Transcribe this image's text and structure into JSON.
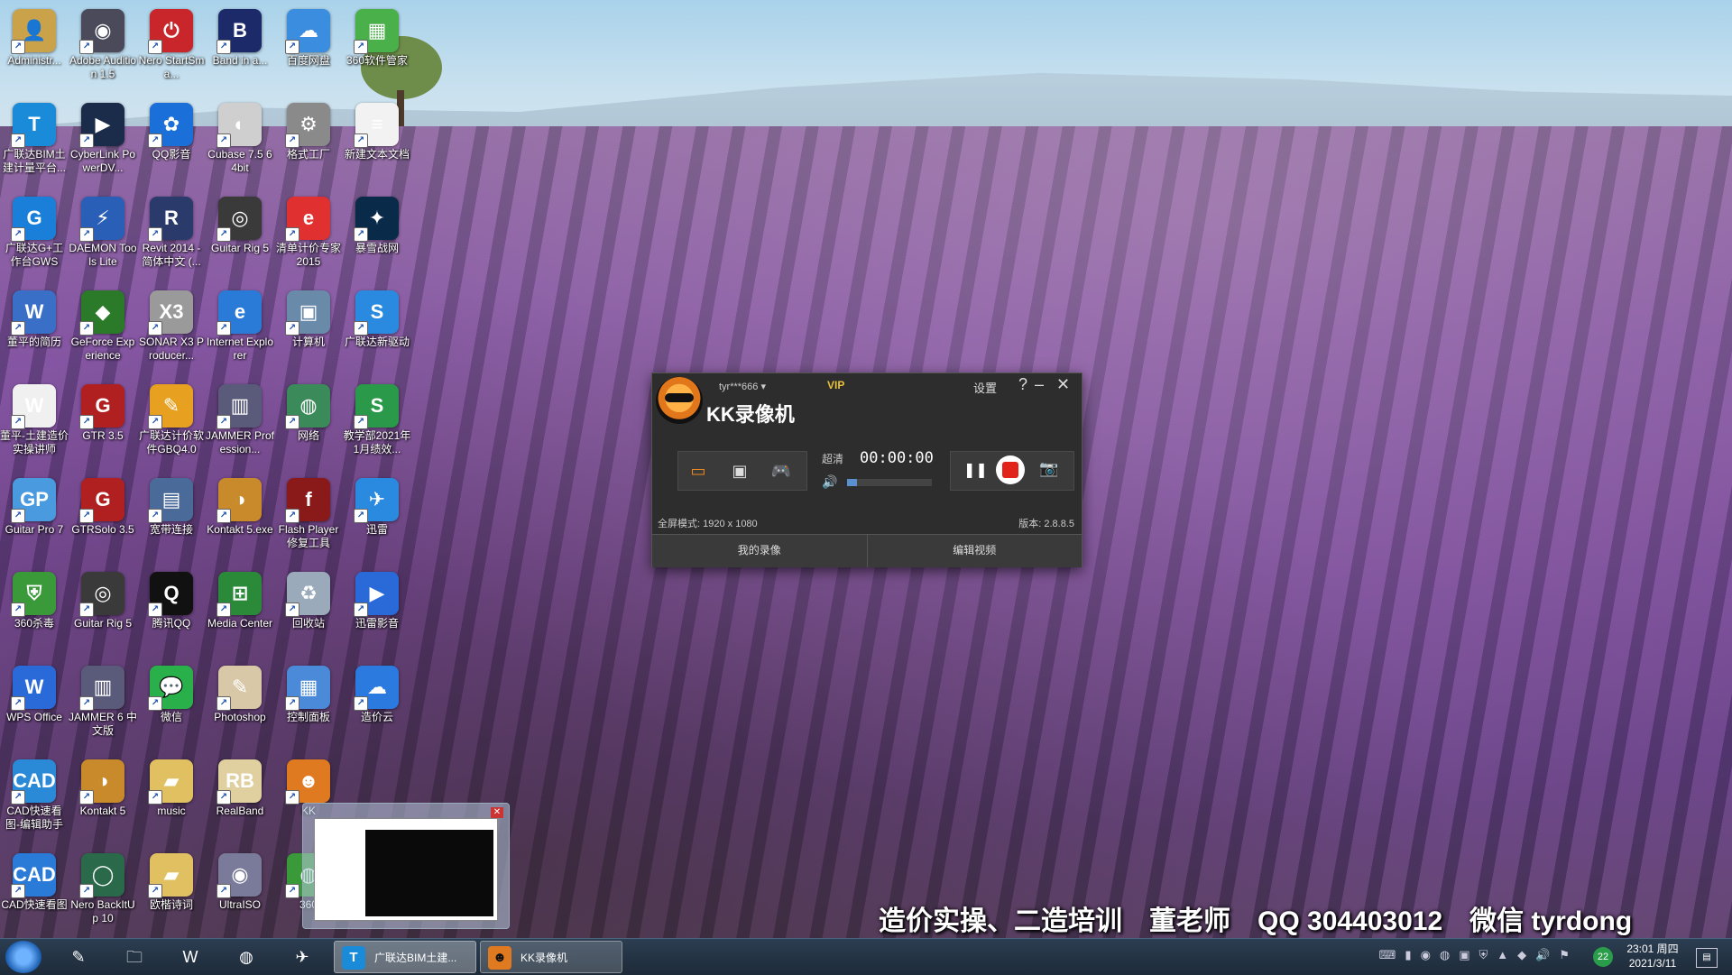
{
  "desktop_icons": [
    {
      "label": "Administr...",
      "color": "#c9a24a",
      "glyph": "👤"
    },
    {
      "label": "Adobe Audition 1.5",
      "color": "#4a4a5a",
      "glyph": "◉"
    },
    {
      "label": "Nero StartSma...",
      "color": "#c8262a",
      "glyph": "⏻"
    },
    {
      "label": "Band in a...",
      "color": "#1c2a6a",
      "glyph": "B"
    },
    {
      "label": "百度网盘",
      "color": "#3b8de0",
      "glyph": "☁"
    },
    {
      "label": "360软件管家",
      "color": "#49b04a",
      "glyph": "▦"
    },
    {
      "label": "广联达BIM土建计量平台...",
      "color": "#1a8bd8",
      "glyph": "T"
    },
    {
      "label": "CyberLink PowerDV...",
      "color": "#1b2b4a",
      "glyph": "▶"
    },
    {
      "label": "QQ影音",
      "color": "#1a6fd8",
      "glyph": "✿"
    },
    {
      "label": "Cubase 7.5 64bit",
      "color": "#cfcfcf",
      "glyph": "◐"
    },
    {
      "label": "格式工厂",
      "color": "#8a8a8a",
      "glyph": "⚙"
    },
    {
      "label": "新建文本文档",
      "color": "#f2f2f2",
      "glyph": "≡"
    },
    {
      "label": "广联达G+工作台GWS",
      "color": "#1a7fd8",
      "glyph": "G"
    },
    {
      "label": "DAEMON Tools Lite",
      "color": "#2a5fb8",
      "glyph": "⚡"
    },
    {
      "label": "Revit 2014 - 简体中文 (...",
      "color": "#2a3a6a",
      "glyph": "R"
    },
    {
      "label": "Guitar Rig 5",
      "color": "#3a3a3a",
      "glyph": "◎"
    },
    {
      "label": "清单计价专家2015",
      "color": "#e03030",
      "glyph": "e"
    },
    {
      "label": "暴雪战网",
      "color": "#0a2a4a",
      "glyph": "✦"
    },
    {
      "label": "董平的简历",
      "color": "#3a6fc8",
      "glyph": "W"
    },
    {
      "label": "GeForce Experience",
      "color": "#2a7a2a",
      "glyph": "◆"
    },
    {
      "label": "SONAR X3 Producer...",
      "color": "#9a9a9a",
      "glyph": "X3"
    },
    {
      "label": "Internet Explorer",
      "color": "#2a7ad8",
      "glyph": "e"
    },
    {
      "label": "计算机",
      "color": "#6a8aaa",
      "glyph": "▣"
    },
    {
      "label": "广联达新驱动",
      "color": "#2a8ae0",
      "glyph": "S"
    },
    {
      "label": "董平-土建造价实操讲师",
      "color": "#f0f0f0",
      "glyph": "W"
    },
    {
      "label": "GTR 3.5",
      "color": "#b02020",
      "glyph": "G"
    },
    {
      "label": "广联达计价软件GBQ4.0",
      "color": "#e8a020",
      "glyph": "✎"
    },
    {
      "label": "JAMMER Profession...",
      "color": "#5a5a7a",
      "glyph": "▥"
    },
    {
      "label": "网络",
      "color": "#3a8a5a",
      "glyph": "◍"
    },
    {
      "label": "教学部2021年1月绩效...",
      "color": "#2a9a4a",
      "glyph": "S"
    },
    {
      "label": "Guitar Pro 7",
      "color": "#4a9ae0",
      "glyph": "GP"
    },
    {
      "label": "GTRSolo 3.5",
      "color": "#b02020",
      "glyph": "G"
    },
    {
      "label": "宽带连接",
      "color": "#4a6a9a",
      "glyph": "▤"
    },
    {
      "label": "Kontakt 5.exe",
      "color": "#c88a2a",
      "glyph": "◑"
    },
    {
      "label": "Flash Player 修复工具",
      "color": "#8a1a1a",
      "glyph": "f"
    },
    {
      "label": "迅雷",
      "color": "#2a8ae0",
      "glyph": "✈"
    },
    {
      "label": "360杀毒",
      "color": "#3a9a3a",
      "glyph": "⛨"
    },
    {
      "label": "Guitar Rig 5",
      "color": "#3a3a3a",
      "glyph": "◎"
    },
    {
      "label": "腾讯QQ",
      "color": "#111111",
      "glyph": "Q"
    },
    {
      "label": "Media Center",
      "color": "#2a8a3a",
      "glyph": "⊞"
    },
    {
      "label": "回收站",
      "color": "#9aaabb",
      "glyph": "♻"
    },
    {
      "label": "迅雷影音",
      "color": "#2a6ad8",
      "glyph": "▶"
    },
    {
      "label": "WPS Office",
      "color": "#2a6ad8",
      "glyph": "W"
    },
    {
      "label": "JAMMER 6 中文版",
      "color": "#5a5a7a",
      "glyph": "▥"
    },
    {
      "label": "微信",
      "color": "#2ab04a",
      "glyph": "💬"
    },
    {
      "label": "Photoshop",
      "color": "#d8c8a8",
      "glyph": "✎"
    },
    {
      "label": "控制面板",
      "color": "#4a8ad8",
      "glyph": "▦"
    },
    {
      "label": "造价云",
      "color": "#2a7ae0",
      "glyph": "☁"
    },
    {
      "label": "CAD快速看图-编辑助手",
      "color": "#2a8ad8",
      "glyph": "CAD"
    },
    {
      "label": "Kontakt 5",
      "color": "#c88a2a",
      "glyph": "◑"
    },
    {
      "label": "music",
      "color": "#e0c060",
      "glyph": "▰"
    },
    {
      "label": "RealBand",
      "color": "#e0d0a0",
      "glyph": "RB"
    },
    {
      "label": "KK",
      "color": "#e07a20",
      "glyph": "☻"
    },
    {
      "label": "",
      "color": "transparent",
      "glyph": ""
    },
    {
      "label": "CAD快速看图",
      "color": "#2a7ad8",
      "glyph": "CAD"
    },
    {
      "label": "Nero BackItUp 10",
      "color": "#2a6a4a",
      "glyph": "◯"
    },
    {
      "label": "欧楷诗词",
      "color": "#e0c060",
      "glyph": "▰"
    },
    {
      "label": "UltraISO",
      "color": "#7a7a9a",
      "glyph": "◉"
    },
    {
      "label": "360",
      "color": "#3a9a3a",
      "glyph": "◍"
    }
  ],
  "kk_window": {
    "username": "tyr***666",
    "vip": "VIP",
    "title": "KK录像机",
    "settings": "设置",
    "help": "?",
    "minimize": "–",
    "close": "✕",
    "mode_icons": [
      "monitor-icon",
      "window-icon",
      "gamepad-icon"
    ],
    "quality": "超清",
    "timer": "00:00:00",
    "volume_level": 0.12,
    "fullscreen_mode": "全屏模式: 1920 x 1080",
    "version": "版本: 2.8.8.5",
    "btn_my_recordings": "我的录像",
    "btn_edit_video": "编辑视频"
  },
  "caption": "造价实操、二造培训　董老师　QQ 304403012　微信 tyrdong",
  "taskbar": {
    "tasks": [
      {
        "label": "广联达BIM土建...",
        "icon": "T",
        "icon_color": "#1a8bd8"
      },
      {
        "label": "KK录像机",
        "icon": "☻",
        "icon_color": "#e07a20"
      }
    ],
    "tray_badge": "22",
    "clock_time": "23:01 周四",
    "clock_date": "2021/3/11"
  }
}
